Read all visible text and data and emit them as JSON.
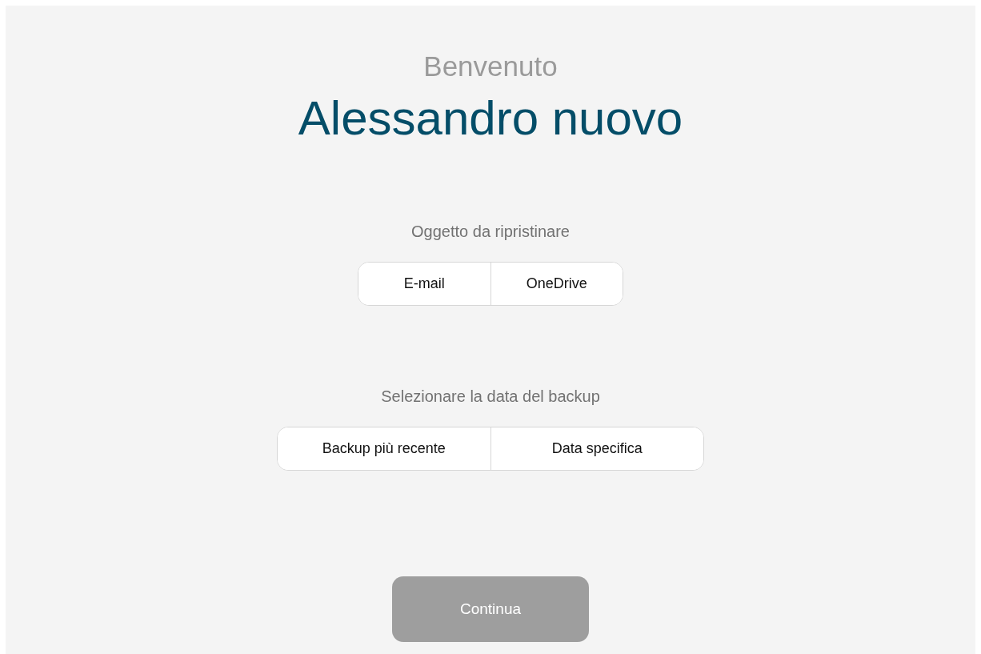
{
  "greeting": "Benvenuto",
  "user_name": "Alessandro nuovo",
  "sections": [
    {
      "label": "Oggetto da ripristinare",
      "options": [
        {
          "label": "E-mail",
          "selected": false
        },
        {
          "label": "OneDrive",
          "selected": false
        }
      ]
    },
    {
      "label": "Selezionare la data del backup",
      "options": [
        {
          "label": "Backup più recente",
          "selected": false
        },
        {
          "label": "Data specifica",
          "selected": false
        }
      ]
    }
  ],
  "continue_button": {
    "label": "Continua",
    "disabled": true
  }
}
